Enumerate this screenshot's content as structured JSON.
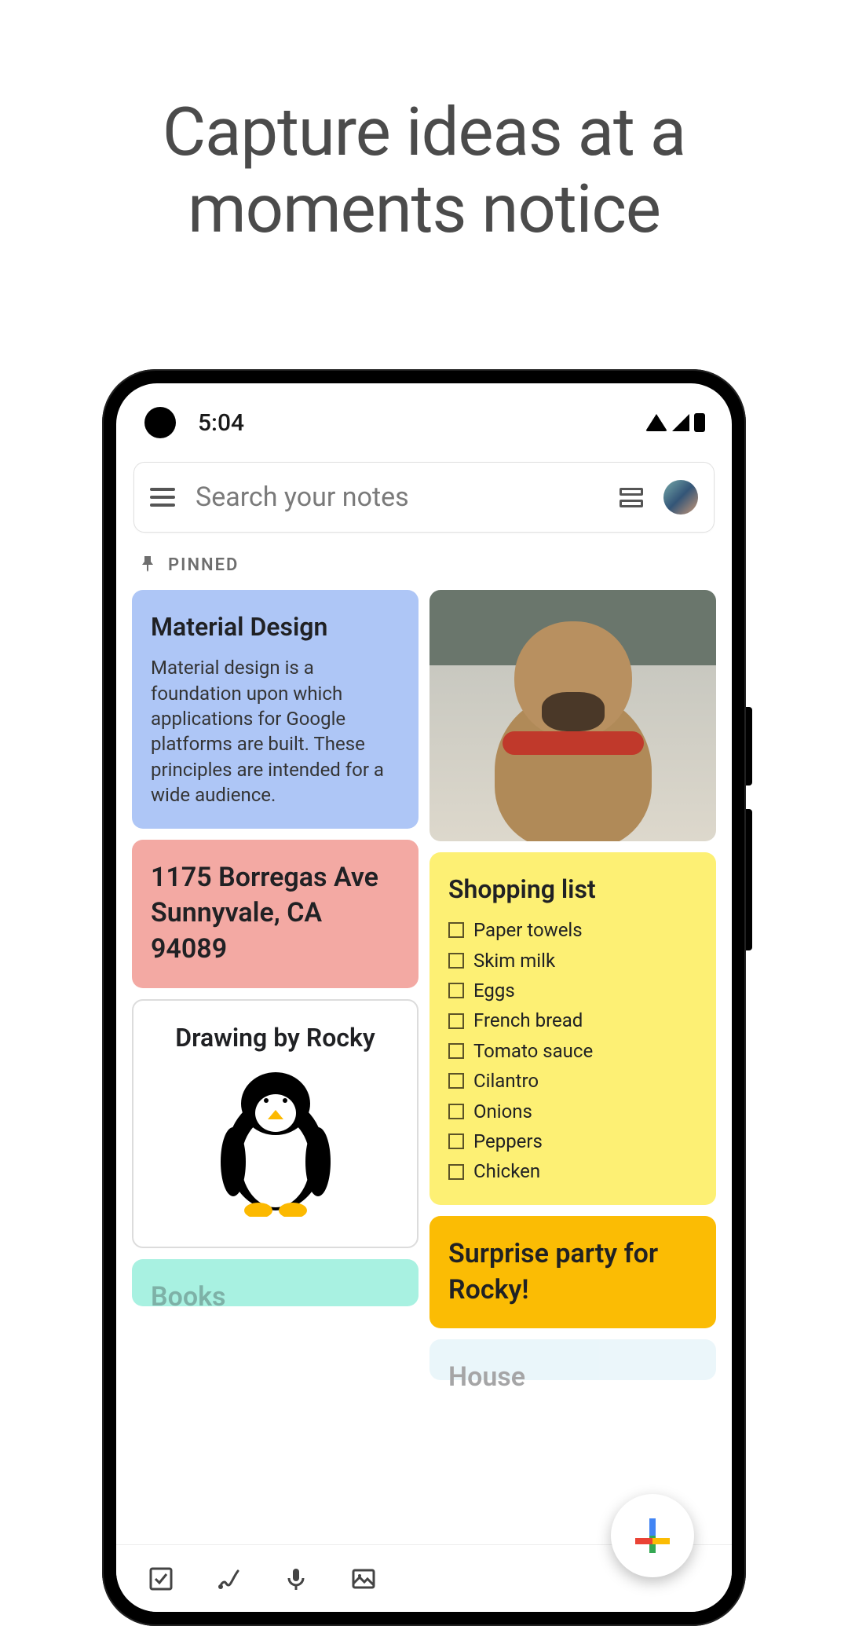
{
  "headline": "Capture ideas at a moments notice",
  "statusbar": {
    "time": "5:04"
  },
  "search": {
    "placeholder": "Search your notes"
  },
  "section": {
    "pinned_label": "PINNED"
  },
  "notes": {
    "material": {
      "title": "Material Design",
      "body": "Material design is a foundation upon which applications for Google platforms are built. These principles are intended for a wide audience."
    },
    "address": {
      "title": "1175 Borregas Ave Sunnyvale, CA 94089"
    },
    "drawing": {
      "title": "Drawing by Rocky"
    },
    "books": {
      "title": "Books"
    },
    "shopping": {
      "title": "Shopping list",
      "items": [
        "Paper towels",
        "Skim milk",
        "Eggs",
        "French bread",
        "Tomato sauce",
        "Cilantro",
        "Onions",
        "Peppers",
        "Chicken"
      ]
    },
    "surprise": {
      "title": "Surprise party for Rocky!"
    },
    "house": {
      "title": "House"
    }
  },
  "colors": {
    "blue": "#aec6f6",
    "pink": "#f3a9a3",
    "yellow": "#fdf074",
    "orange": "#fbbc04",
    "teal": "#a8f1e1"
  }
}
